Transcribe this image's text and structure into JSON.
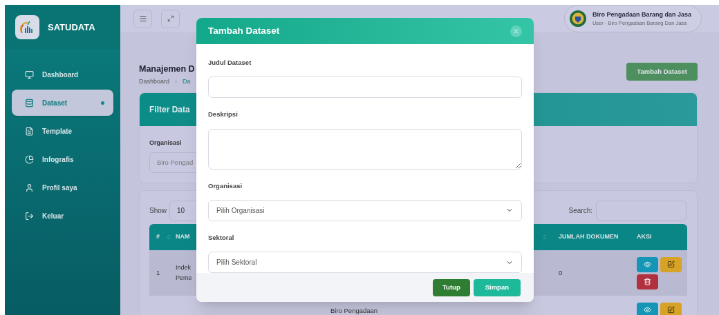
{
  "sidebar": {
    "brand": "SATUDATA",
    "items": [
      {
        "label": "Dashboard",
        "selected": false
      },
      {
        "label": "Dataset",
        "selected": true
      },
      {
        "label": "Template",
        "selected": false
      },
      {
        "label": "Infografis",
        "selected": false
      },
      {
        "label": "Profil saya",
        "selected": false
      },
      {
        "label": "Keluar",
        "selected": false
      }
    ]
  },
  "header": {
    "user": {
      "name": "Biro Pengadaan Barang dan Jasa",
      "role": "User - Biro Pengadaan Barang Dan Jasa"
    }
  },
  "page": {
    "title": "Manajemen D",
    "breadcrumb": [
      "Dashboard",
      "Da"
    ],
    "breadcrumb_separator": "›",
    "add_button": "Tambah Dataset"
  },
  "filter": {
    "title": "Filter Data",
    "label": "Organisasi",
    "value": "Biro Pengad"
  },
  "table": {
    "show_label": "Show",
    "page_size": "10",
    "search_label": "Search:",
    "columns": [
      "#",
      "NAM",
      "",
      "JUMLAH DOKUMEN",
      "AKSI"
    ],
    "rows": [
      {
        "number": "1",
        "name": "Indek Peme",
        "count": "0",
        "actions": [
          {
            "kind": "view"
          },
          {
            "kind": "edit"
          },
          {
            "kind": "delete"
          }
        ]
      },
      {
        "organisation": "Biro Pengadaan",
        "actions": [
          {
            "kind": "view"
          },
          {
            "kind": "edit"
          }
        ]
      }
    ]
  },
  "modal": {
    "title": "Tambah Dataset",
    "fields": [
      {
        "label": "Judul Dataset",
        "kind": "text"
      },
      {
        "label": "Deskripsi",
        "kind": "textarea"
      },
      {
        "label": "Organisasi",
        "kind": "select",
        "placeholder": "Pilih Organisasi"
      },
      {
        "label": "Sektoral",
        "kind": "select",
        "placeholder": "Pilih Sektoral"
      }
    ],
    "buttons": [
      {
        "label": "Tutup",
        "kind": "secondary"
      },
      {
        "label": "Simpan",
        "kind": "primary"
      }
    ]
  }
}
